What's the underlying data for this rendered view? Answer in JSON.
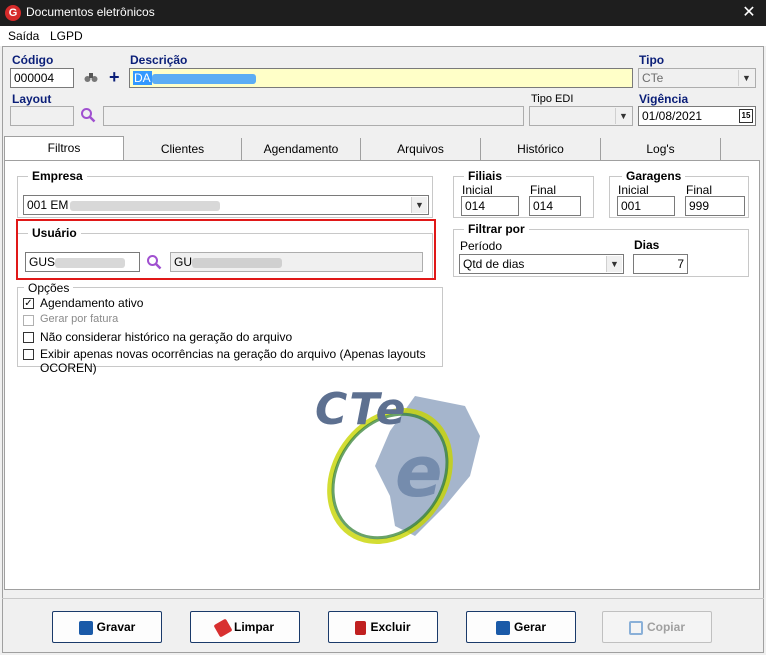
{
  "window": {
    "title": "Documentos eletrônicos",
    "app_icon": "G",
    "close_glyph": "✕"
  },
  "menu": {
    "items": [
      "Saída",
      "LGPD"
    ]
  },
  "header": {
    "codigo_label": "Código",
    "codigo_value": "000004",
    "descricao_label": "Descrição",
    "descricao_value": "DA",
    "tipo_label": "Tipo",
    "tipo_value": "CTe",
    "layout_label": "Layout",
    "layout_value": "",
    "tipo_edi_label": "Tipo EDI",
    "tipo_edi_value": "",
    "vigencia_label": "Vigência",
    "vigencia_value": "01/08/2021",
    "calendar_glyph": "15"
  },
  "tabs": [
    "Filtros",
    "Clientes",
    "Agendamento",
    "Arquivos",
    "Histórico",
    "Log's"
  ],
  "filtros": {
    "empresa": {
      "title": "Empresa",
      "value": "001 EM"
    },
    "filiais": {
      "title": "Filiais",
      "inicial_label": "Inicial",
      "final_label": "Final",
      "inicial": "014",
      "final": "014"
    },
    "garagens": {
      "title": "Garagens",
      "inicial_label": "Inicial",
      "final_label": "Final",
      "inicial": "001",
      "final": "999"
    },
    "usuario": {
      "title": "Usuário",
      "code": "GUS",
      "name": "GU"
    },
    "filtrar_por": {
      "title": "Filtrar por",
      "periodo_label": "Período",
      "periodo_value": "Qtd de dias",
      "dias_label": "Dias",
      "dias_value": "7"
    },
    "opcoes": {
      "title": "Opções",
      "items": [
        {
          "label": "Agendamento ativo",
          "checked": true,
          "enabled": true
        },
        {
          "label": "Gerar por fatura",
          "checked": false,
          "enabled": false
        },
        {
          "label": "Não considerar histórico na geração do arquivo",
          "checked": false,
          "enabled": true
        },
        {
          "label": "Exibir apenas novas ocorrências na geração do arquivo (Apenas layouts OCOREN)",
          "checked": false,
          "enabled": true
        }
      ]
    },
    "logo_text": "CTe"
  },
  "buttons": {
    "gravar": "Gravar",
    "limpar": "Limpar",
    "excluir": "Excluir",
    "gerar": "Gerar",
    "copiar": "Copiar"
  },
  "colors": {
    "accent_label": "#0a1e78",
    "highlight": "#e01818",
    "selection": "#3399ff"
  }
}
